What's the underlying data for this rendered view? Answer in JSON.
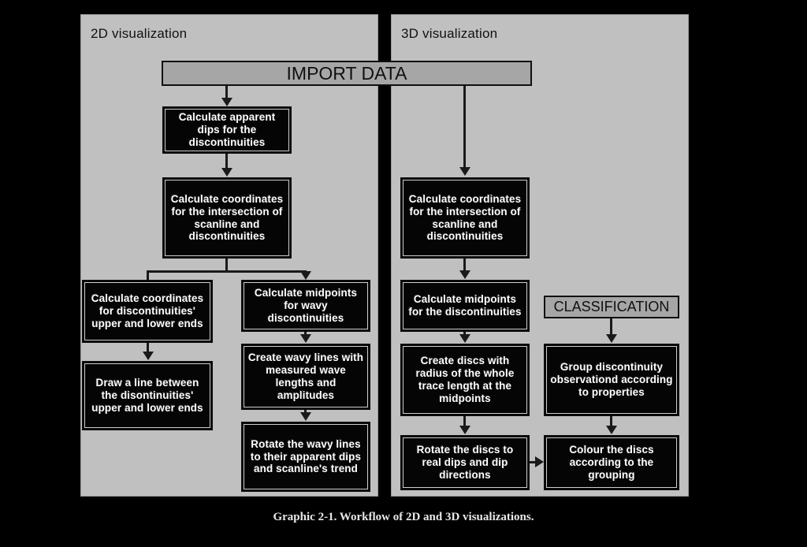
{
  "diagram": {
    "caption": "Graphic 2-1. Workflow of 2D and 3D visualizations.",
    "panels": {
      "left": {
        "title": "2D visualization"
      },
      "right": {
        "title": "3D visualization"
      }
    },
    "headers": {
      "import_data": "IMPORT DATA",
      "classification": "CLASSIFICATION"
    },
    "nodes_2d": {
      "apparent_dips": "Calculate apparent dips for the discontinuities",
      "intersection_coords": "Calculate coordinates for the intersection of scanline and discontinuities",
      "ends_coords": "Calculate coordinates for discontinuities' upper and lower ends",
      "draw_line": "Draw a line between the disontinuities' upper and lower ends",
      "wavy_midpoints": "Calculate midpoints for wavy discontinuities",
      "wavy_lines": "Create wavy lines with measured wave lengths and amplitudes",
      "rotate_wavy": "Rotate the wavy lines to their apparent dips and scanline's trend"
    },
    "nodes_3d": {
      "intersection_coords": "Calculate coordinates for the intersection of scanline and discontinuities",
      "midpoints": "Calculate midpoints for the discontinuities",
      "create_discs": "Create discs with radius of the whole trace length at the midpoints",
      "rotate_discs": "Rotate the discs to real dips and dip directions",
      "group_observations": "Group discontinuity observationd according to properties",
      "colour_discs": "Colour the discs according to the grouping"
    },
    "colors": {
      "background": "#000000",
      "panel": "#c0c0c0",
      "header_box": "#a6a6a6",
      "process_box": "#050505",
      "process_text": "#ffffff"
    }
  }
}
